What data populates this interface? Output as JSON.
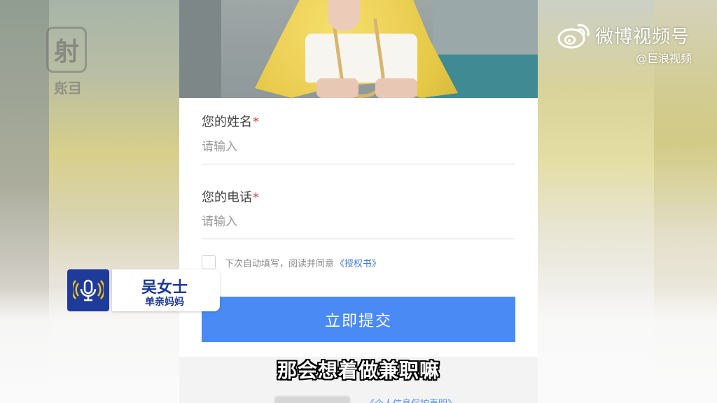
{
  "watermark": {
    "platform_name": "微博视频号",
    "handle": "@巨浪视频"
  },
  "station_logo": {
    "mark": "射",
    "sub": "巨浪"
  },
  "form": {
    "name_label": "您的姓名",
    "name_required_mark": "*",
    "name_placeholder": "请输入",
    "phone_label": "您的电话",
    "phone_required_mark": "*",
    "phone_placeholder": "请输入",
    "agree_text": "下次自动填写，阅读并同意",
    "agree_link": "《授权书》",
    "agree_checked": false,
    "submit_label": "立即提交",
    "footer_link": "《个人信息保护声明》"
  },
  "lower_third": {
    "name": "吴女士",
    "role": "单亲妈妈",
    "icon": "microphone-icon"
  },
  "subtitle": "那会想着做兼职嘛",
  "colors": {
    "submit_button": "#4a8af4",
    "link": "#3f7bd8",
    "required": "#d23b3b",
    "name_tag_text": "#1c3890",
    "mic_box": "#1e3a9a"
  }
}
